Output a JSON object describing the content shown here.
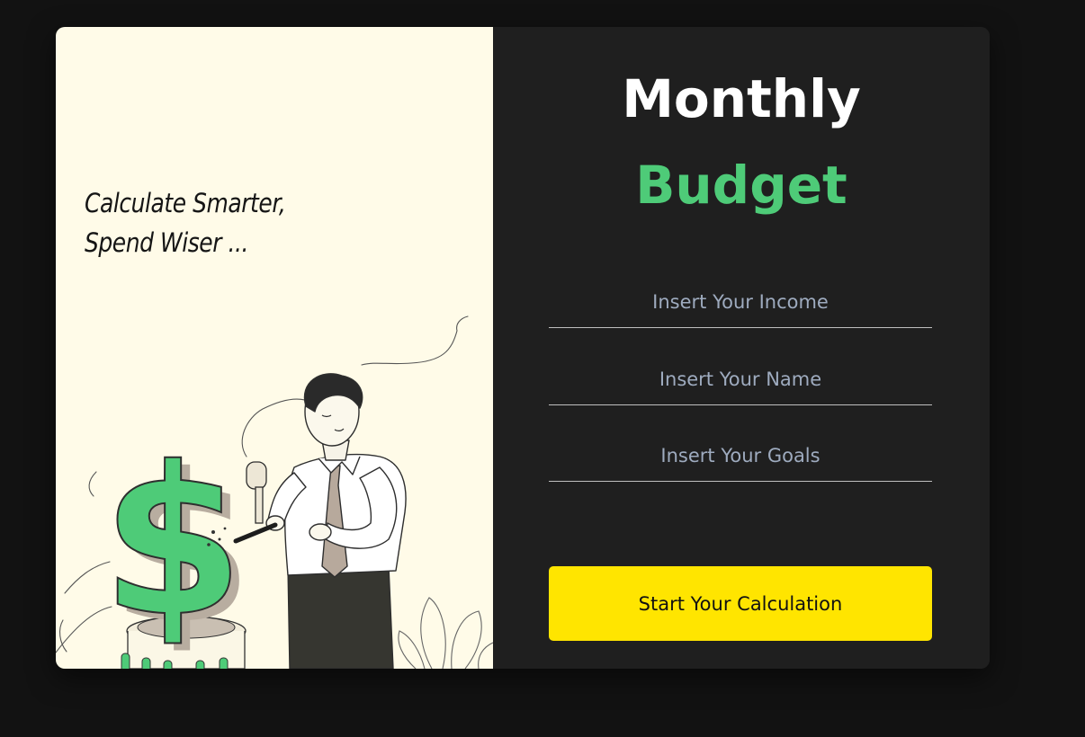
{
  "left_panel": {
    "tagline_line1": "Calculate Smarter,",
    "tagline_line2": "Spend Wiser ..."
  },
  "form": {
    "title_line1": "Monthly",
    "title_line2": "Budget",
    "income_placeholder": "Insert Your Income",
    "name_placeholder": "Insert Your Name",
    "goals_placeholder": "Insert Your Goals",
    "submit_label": "Start Your Calculation"
  },
  "colors": {
    "page_background": "#121212",
    "panel_dark": "#1f1f1f",
    "panel_light": "#fffbe8",
    "accent_green": "#4ecb78",
    "button_yellow": "#ffe500",
    "placeholder": "#9eabbf"
  },
  "illustration": {
    "subject": "man-sculpting-dollar-sign-icon"
  }
}
